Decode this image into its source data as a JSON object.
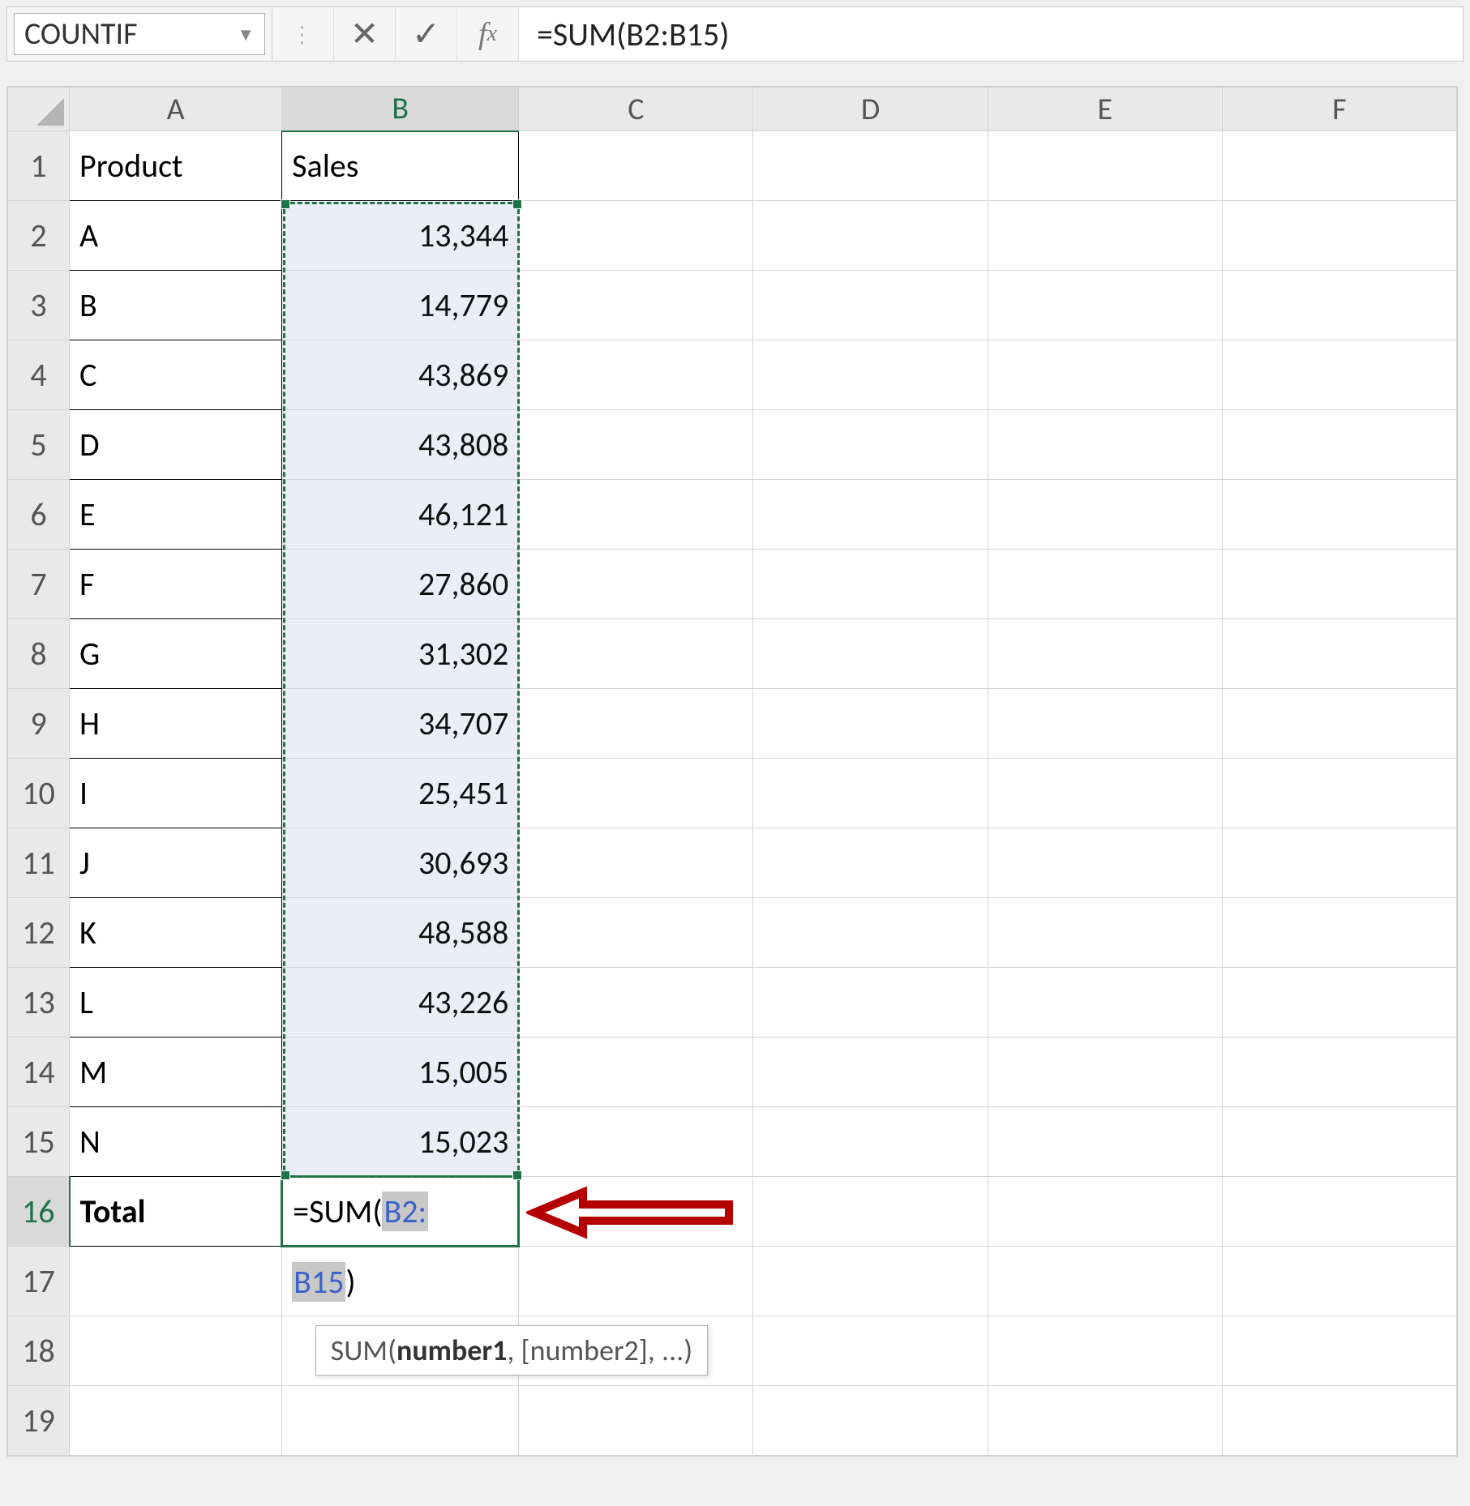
{
  "formulaBar": {
    "nameBox": "COUNTIF",
    "formula": "=SUM(B2:B15)"
  },
  "columns": [
    "A",
    "B",
    "C",
    "D",
    "E",
    "F"
  ],
  "selectedColumn": "B",
  "activeRow": 16,
  "headers": {
    "A": "Product",
    "B": "Sales"
  },
  "rows": [
    {
      "r": 2,
      "a": "A",
      "b": "13,344"
    },
    {
      "r": 3,
      "a": "B",
      "b": "14,779"
    },
    {
      "r": 4,
      "a": "C",
      "b": "43,869"
    },
    {
      "r": 5,
      "a": "D",
      "b": "43,808"
    },
    {
      "r": 6,
      "a": "E",
      "b": "46,121"
    },
    {
      "r": 7,
      "a": "F",
      "b": "27,860"
    },
    {
      "r": 8,
      "a": "G",
      "b": "31,302"
    },
    {
      "r": 9,
      "a": "H",
      "b": "34,707"
    },
    {
      "r": 10,
      "a": "I",
      "b": "25,451"
    },
    {
      "r": 11,
      "a": "J",
      "b": "30,693"
    },
    {
      "r": 12,
      "a": "K",
      "b": "48,588"
    },
    {
      "r": 13,
      "a": "L",
      "b": "43,226"
    },
    {
      "r": 14,
      "a": "M",
      "b": "15,005"
    },
    {
      "r": 15,
      "a": "N",
      "b": "15,023"
    }
  ],
  "totalRow": {
    "r": 16,
    "label": "Total",
    "formula_line1_pre": "=SUM(",
    "formula_line1_ref": "B2:",
    "formula_line2_ref": "B15",
    "formula_line2_post": ")"
  },
  "extraRows": [
    17,
    18,
    19
  ],
  "tooltip": {
    "fn": "SUM(",
    "arg1": "number1",
    "rest": ", [number2], ...)"
  }
}
